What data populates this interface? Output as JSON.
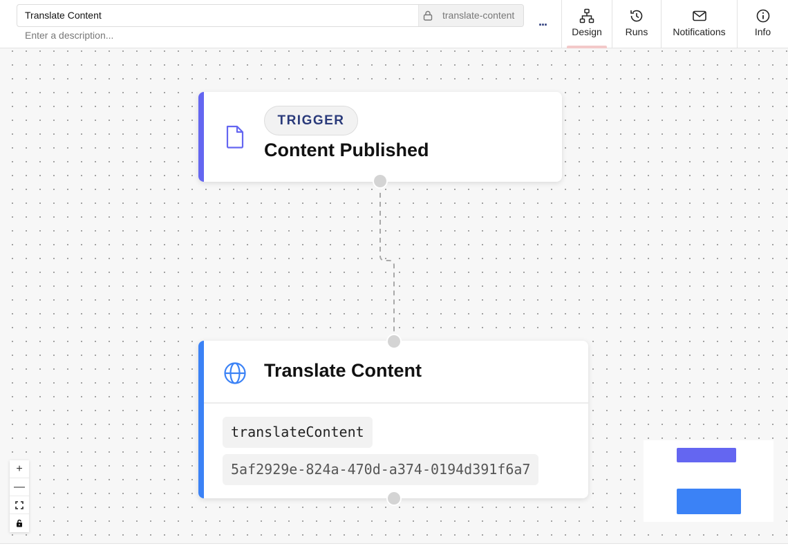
{
  "header": {
    "workflow_title": "Translate Content",
    "slug": "translate-content",
    "description_placeholder": "Enter a description...",
    "more_label": "...",
    "tabs": [
      {
        "label": "Design",
        "icon": "hierarchy-icon",
        "active": true
      },
      {
        "label": "Runs",
        "icon": "history-icon",
        "active": false
      },
      {
        "label": "Notifications",
        "icon": "envelope-icon",
        "active": false
      },
      {
        "label": "Info",
        "icon": "info-icon",
        "active": false
      }
    ]
  },
  "canvas": {
    "trigger_node": {
      "badge": "TRIGGER",
      "title": "Content Published",
      "icon": "document-icon",
      "accent_color": "#6466f1"
    },
    "action_node": {
      "title": "Translate Content",
      "icon": "globe-icon",
      "function_name": "translateContent",
      "id": "5af2929e-824a-470d-a374-0194d391f6a7",
      "accent_color": "#3b82f6"
    }
  },
  "controls": {
    "zoom_in": "+",
    "zoom_out": "—",
    "fit_view": "fit-view-icon",
    "lock": "lock-icon"
  },
  "minimap": {
    "node_colors": [
      "#6466f1",
      "#3b82f6"
    ]
  }
}
